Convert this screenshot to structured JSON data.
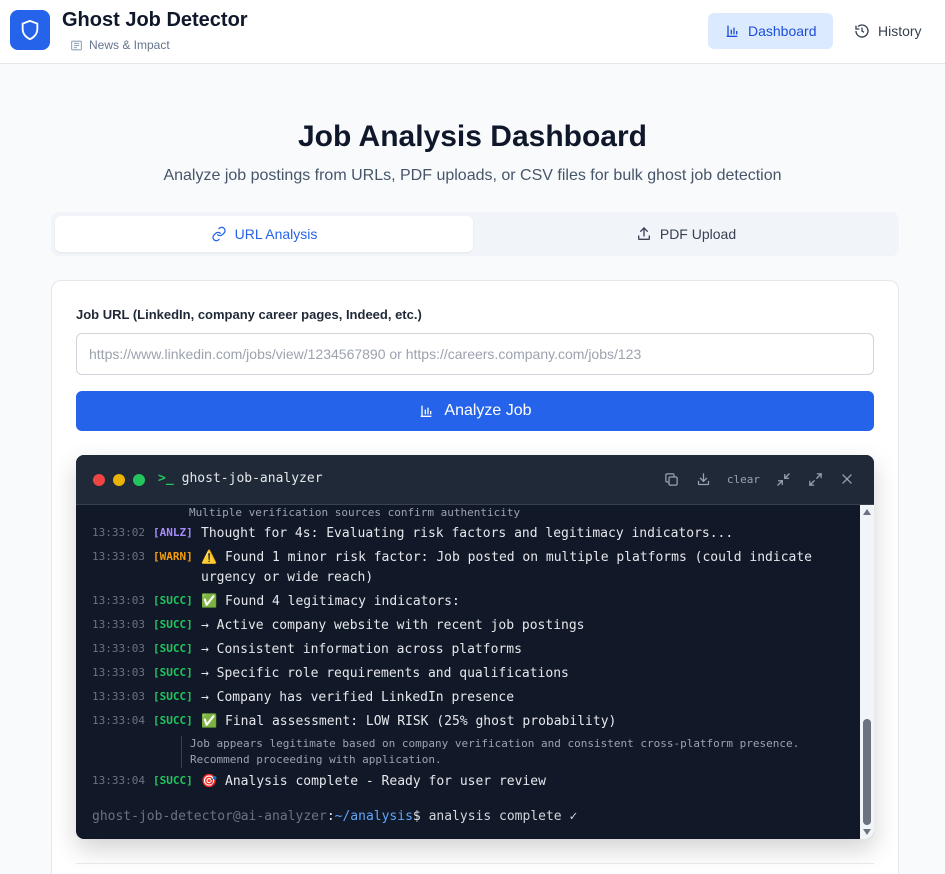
{
  "header": {
    "app_title": "Ghost Job Detector",
    "subtitle": "News & Impact",
    "nav": {
      "dashboard_label": "Dashboard",
      "history_label": "History"
    }
  },
  "hero": {
    "title": "Job Analysis Dashboard",
    "subtitle": "Analyze job postings from URLs, PDF uploads, or CSV files for bulk ghost job detection"
  },
  "tabs": {
    "url_label": "URL Analysis",
    "pdf_label": "PDF Upload",
    "active": "URL Analysis"
  },
  "form": {
    "url_label": "Job URL (LinkedIn, company career pages, Indeed, etc.)",
    "url_placeholder": "https://www.linkedin.com/jobs/view/1234567890 or https://careers.company.com/jobs/123",
    "url_value": "",
    "analyze_label": "Analyze Job"
  },
  "terminal": {
    "title": "ghost-job-analyzer",
    "clear_label": "clear",
    "top_detail": "Multiple verification sources confirm authenticity",
    "logs": [
      {
        "time": "13:33:02",
        "level": "[ANLZ]",
        "message": "Thought for 4s: Evaluating risk factors and legitimacy indicators..."
      },
      {
        "time": "13:33:03",
        "level": "[WARN]",
        "message": "⚠️ Found 1 minor risk factor: Job posted on multiple platforms (could indicate urgency or wide reach)"
      },
      {
        "time": "13:33:03",
        "level": "[SUCC]",
        "message": "✅ Found 4 legitimacy indicators:"
      },
      {
        "time": "13:33:03",
        "level": "[SUCC]",
        "message": "→ Active company website with recent job postings"
      },
      {
        "time": "13:33:03",
        "level": "[SUCC]",
        "message": "→ Consistent information across platforms"
      },
      {
        "time": "13:33:03",
        "level": "[SUCC]",
        "message": "→ Specific role requirements and qualifications"
      },
      {
        "time": "13:33:03",
        "level": "[SUCC]",
        "message": "→ Company has verified LinkedIn presence"
      },
      {
        "time": "13:33:04",
        "level": "[SUCC]",
        "message": "✅ Final assessment: LOW RISK (25% ghost probability)"
      },
      {
        "time": "13:33:04",
        "level": "[SUCC]",
        "message": "🎯 Analysis complete - Ready for user review"
      }
    ],
    "final_detail": "Job appears legitimate based on company verification and consistent cross-platform presence. Recommend proceeding with application.",
    "prompt": {
      "user_host": "ghost-job-detector@ai-analyzer",
      "colon": ":",
      "path": "~/analysis",
      "dollar": "$",
      "command": " analysis complete ✓"
    }
  },
  "colors": {
    "primary": "#2563eb",
    "terminal_bg": "#111827",
    "anlz": "#a78bfa",
    "warn": "#f59e0b",
    "succ": "#22c55e"
  }
}
